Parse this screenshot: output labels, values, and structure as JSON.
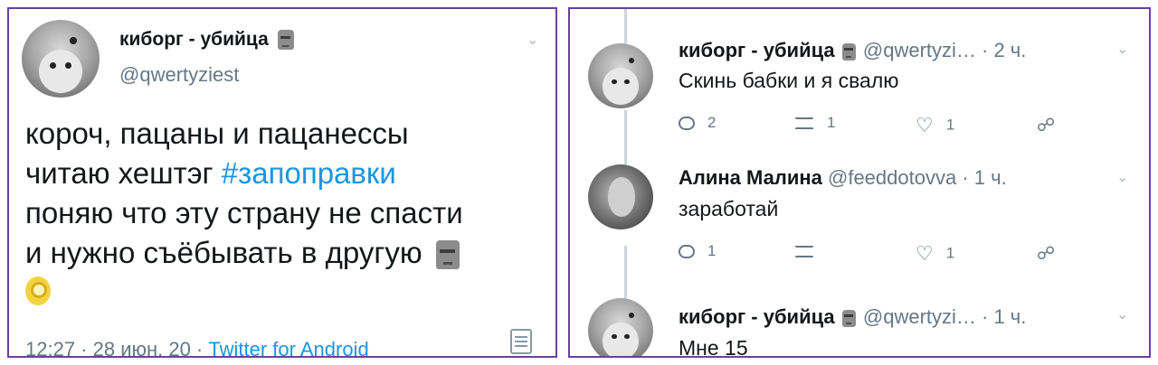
{
  "left_tweet": {
    "author_name": "киборг - убийца",
    "author_handle": "@qwertyziest",
    "body": {
      "line1": "короч,  пацаны и пацанессы",
      "line2_prefix": "читаю хештэг ",
      "hashtag": "#запоправки",
      "line3": "поняю что эту страну не спасти",
      "line4": "и нужно съёбывать в другую"
    },
    "footer": {
      "datetime": "12:27 · 28 июн. 20 · ",
      "source": "Twitter for Android"
    },
    "icons": [
      "chevron-down-icon",
      "moai-emoji",
      "ok-hand-emoji",
      "analytics-icon"
    ]
  },
  "replies": [
    {
      "author_name": "киборг - убийца",
      "author_handle_time": " @qwertyzi…  · 2 ч.",
      "text": "Скинь бабки и я свалю",
      "counts": {
        "reply": "2",
        "retweet": "1",
        "like": "1"
      }
    },
    {
      "author_name": "Алина Малина",
      "author_handle_time": " @feeddotovva · 1 ч.",
      "text": "заработай",
      "counts": {
        "reply": "1",
        "retweet": "",
        "like": "1"
      }
    },
    {
      "author_name": "киборг - убийца",
      "author_handle_time": " @qwertyzi…  · 1 ч.",
      "text": "Мне 15",
      "counts": {}
    }
  ],
  "colors": {
    "border": "#6b3fa0",
    "hashtag": "#1b95e0",
    "muted": "#657786"
  }
}
